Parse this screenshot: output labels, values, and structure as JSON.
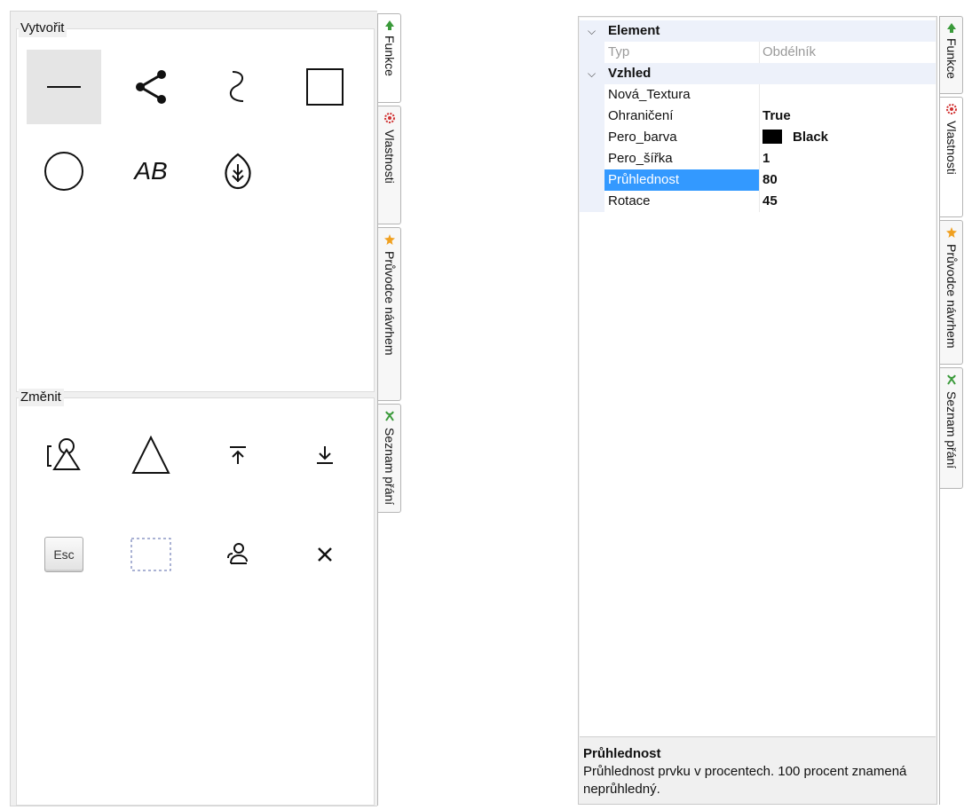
{
  "left": {
    "create_group": {
      "title": "Vytvořit"
    },
    "create_tools": [
      {
        "name": "line-tool",
        "icon": "horizontal-line-icon",
        "selected": true
      },
      {
        "name": "connector-tool",
        "icon": "share-nodes-icon"
      },
      {
        "name": "curve-tool",
        "icon": "curve-icon"
      },
      {
        "name": "rectangle-tool",
        "icon": "square-icon"
      },
      {
        "name": "ellipse-tool",
        "icon": "circle-icon"
      },
      {
        "name": "text-tool",
        "icon": "text-ab-icon",
        "text": "AB"
      },
      {
        "name": "leaf-tool",
        "icon": "leaf-icon"
      }
    ],
    "modify_group": {
      "title": "Změnit"
    },
    "modify_tools": [
      {
        "name": "edit-shape-tool",
        "icon": "shape-edit-icon"
      },
      {
        "name": "triangle-tool",
        "icon": "triangle-icon"
      },
      {
        "name": "bring-to-front-tool",
        "icon": "arrow-up-to-top-icon"
      },
      {
        "name": "send-to-back-tool",
        "icon": "arrow-down-to-bottom-icon"
      },
      {
        "name": "escape-tool",
        "icon": "esc-key-icon",
        "text": "Esc"
      },
      {
        "name": "selection-tool",
        "icon": "dashed-rectangle-icon"
      },
      {
        "name": "group-tool",
        "icon": "group-person-icon"
      },
      {
        "name": "delete-tool",
        "icon": "close-x-icon"
      }
    ],
    "tabs": [
      {
        "label": "Funkce",
        "icon": "tree-icon",
        "active": true
      },
      {
        "label": "Vlastnosti",
        "icon": "gear-red-icon"
      },
      {
        "label": "Průvodce návrhem",
        "icon": "star-wand-icon"
      },
      {
        "label": "Seznam přání",
        "icon": "ribbon-icon"
      }
    ]
  },
  "right": {
    "tabs": [
      {
        "label": "Funkce",
        "icon": "tree-icon"
      },
      {
        "label": "Vlastnosti",
        "icon": "gear-red-icon",
        "active": true
      },
      {
        "label": "Průvodce návrhem",
        "icon": "star-wand-icon"
      },
      {
        "label": "Seznam přání",
        "icon": "ribbon-icon"
      }
    ],
    "categories": [
      {
        "title": "Element",
        "properties": [
          {
            "name": "Typ",
            "value": "Obdélník",
            "readonly": true
          }
        ]
      },
      {
        "title": "Vzhled",
        "properties": [
          {
            "name": "Nová_Textura",
            "value": ""
          },
          {
            "name": "Ohraničení",
            "value": "True"
          },
          {
            "name": "Pero_barva",
            "value": "Black",
            "swatch": "#000000"
          },
          {
            "name": "Pero_šířka",
            "value": "1"
          },
          {
            "name": "Průhlednost",
            "value": "80",
            "selected": true
          },
          {
            "name": "Rotace",
            "value": "45"
          }
        ]
      }
    ],
    "description": {
      "title": "Průhlednost",
      "text": "Průhlednost prvku v procentech. 100 procent znamená neprůhledný."
    }
  },
  "colors": {
    "selection": "#3399ff",
    "category_bg": "#edf1fa",
    "panel_bg": "#f0f0f0"
  }
}
